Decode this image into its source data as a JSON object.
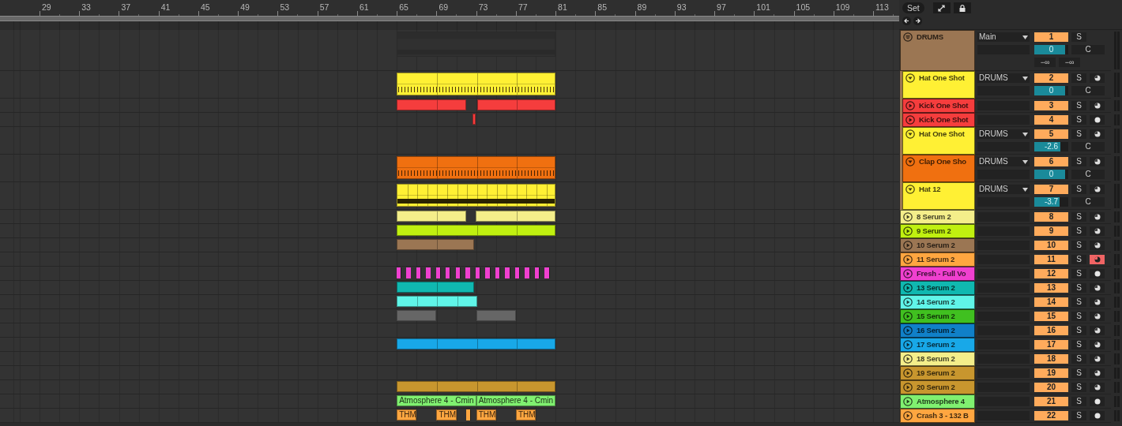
{
  "ruler": [
    "29",
    "33",
    "37",
    "41",
    "45",
    "49",
    "53",
    "57",
    "61",
    "65",
    "69",
    "73",
    "77",
    "81",
    "85",
    "89",
    "93",
    "97",
    "101",
    "105",
    "109",
    "113"
  ],
  "toolbar": {
    "set_button": "Set"
  },
  "tracks": [
    {
      "name": "DRUMS",
      "color": "#9b7653",
      "kind": "group",
      "expanded": true,
      "routing": "Main",
      "number": "1",
      "solo": "S",
      "volume": {
        "value": "0",
        "level": 0.9
      },
      "pan": "C",
      "peaks": [
        "−∞",
        "−∞"
      ],
      "children": [
        {
          "name": "Hat One Shot",
          "color": "#fff034",
          "kind": "track",
          "expanded": true,
          "routing": "DRUMS",
          "number": "2",
          "solo": "S",
          "volume": {
            "value": "0",
            "level": 0.9
          },
          "pan": "C",
          "record": {
            "kind": "half",
            "armed": false
          }
        },
        {
          "name": "Kick One Shot",
          "color": "#f53d3d",
          "kind": "track",
          "expanded": false,
          "number": "3",
          "solo": "S",
          "record": {
            "kind": "half",
            "armed": false
          }
        },
        {
          "name": "Kick One Shot",
          "color": "#f53d3d",
          "kind": "track",
          "expanded": false,
          "number": "4",
          "solo": "S",
          "record": {
            "kind": "dot",
            "armed": false
          }
        },
        {
          "name": "Hat One Shot",
          "color": "#fff034",
          "kind": "track",
          "expanded": true,
          "routing": "DRUMS",
          "number": "5",
          "solo": "S",
          "volume": {
            "value": "-2.6",
            "level": 0.77
          },
          "pan": "C",
          "record": {
            "kind": "half",
            "armed": false
          }
        },
        {
          "name": "Clap One Sho",
          "color": "#f07010",
          "kind": "track",
          "expanded": true,
          "routing": "DRUMS",
          "number": "6",
          "solo": "S",
          "volume": {
            "value": "0",
            "level": 0.9
          },
          "pan": "C",
          "record": {
            "kind": "half",
            "armed": false
          }
        },
        {
          "name": "Hat 12",
          "color": "#fff034",
          "kind": "track",
          "expanded": true,
          "routing": "DRUMS",
          "number": "7",
          "solo": "S",
          "volume": {
            "value": "-3.7",
            "level": 0.74
          },
          "pan": "C",
          "record": {
            "kind": "half",
            "armed": false
          }
        }
      ]
    },
    {
      "name": "8 Serum 2",
      "color": "#f4ee8a",
      "kind": "track",
      "expanded": false,
      "number": "8",
      "solo": "S",
      "record": {
        "kind": "half",
        "armed": false
      }
    },
    {
      "name": "9 Serum 2",
      "color": "#c0f010",
      "kind": "track",
      "expanded": false,
      "number": "9",
      "solo": "S",
      "record": {
        "kind": "half",
        "armed": false
      }
    },
    {
      "name": "10 Serum 2",
      "color": "#9b7653",
      "kind": "track",
      "expanded": false,
      "number": "10",
      "solo": "S",
      "record": {
        "kind": "half",
        "armed": false
      }
    },
    {
      "name": "11 Serum 2",
      "color": "#ffa640",
      "kind": "track",
      "expanded": false,
      "number": "11",
      "solo": "S",
      "record": {
        "kind": "half",
        "armed": true
      }
    },
    {
      "name": "Fresh - Full Vo",
      "color": "#f040d0",
      "kind": "track",
      "expanded": false,
      "number": "12",
      "solo": "S",
      "record": {
        "kind": "dot",
        "armed": false
      }
    },
    {
      "name": "13 Serum 2",
      "color": "#10b8b0",
      "kind": "track",
      "expanded": false,
      "number": "13",
      "solo": "S",
      "record": {
        "kind": "half",
        "armed": false
      }
    },
    {
      "name": "14 Serum 2",
      "color": "#60f5e8",
      "kind": "track",
      "expanded": false,
      "number": "14",
      "solo": "S",
      "record": {
        "kind": "half",
        "armed": false
      }
    },
    {
      "name": "15 Serum 2",
      "color": "#40c020",
      "kind": "track",
      "expanded": false,
      "number": "15",
      "solo": "S",
      "record": {
        "kind": "half",
        "armed": false
      }
    },
    {
      "name": "16 Serum 2",
      "color": "#1080c8",
      "kind": "track",
      "expanded": false,
      "number": "16",
      "solo": "S",
      "record": {
        "kind": "half",
        "armed": false
      }
    },
    {
      "name": "17 Serum 2",
      "color": "#18a8e8",
      "kind": "track",
      "expanded": false,
      "number": "17",
      "solo": "S",
      "record": {
        "kind": "half",
        "armed": false
      }
    },
    {
      "name": "18 Serum 2",
      "color": "#f4ee8a",
      "kind": "track",
      "expanded": false,
      "number": "18",
      "solo": "S",
      "record": {
        "kind": "half",
        "armed": false
      }
    },
    {
      "name": "19 Serum 2",
      "color": "#c8962e",
      "kind": "track",
      "expanded": false,
      "number": "19",
      "solo": "S",
      "record": {
        "kind": "half",
        "armed": false
      }
    },
    {
      "name": "20 Serum 2",
      "color": "#c8962e",
      "kind": "track",
      "expanded": false,
      "number": "20",
      "solo": "S",
      "record": {
        "kind": "half",
        "armed": false
      }
    },
    {
      "name": "Atmosphere 4",
      "color": "#80f070",
      "kind": "track",
      "expanded": false,
      "number": "21",
      "solo": "S",
      "record": {
        "kind": "dot",
        "armed": false
      },
      "clip_labels": [
        "Atmosphere 4 - Cmin",
        "Atmosphere 4 - Cmin"
      ]
    },
    {
      "name": "Crash 3 - 132 B",
      "color": "#ffa640",
      "kind": "track",
      "expanded": false,
      "number": "22",
      "solo": "S",
      "record": {
        "kind": "dot",
        "armed": false
      },
      "clip_labels": [
        "THM",
        "THM",
        "THM",
        "THM"
      ]
    }
  ]
}
